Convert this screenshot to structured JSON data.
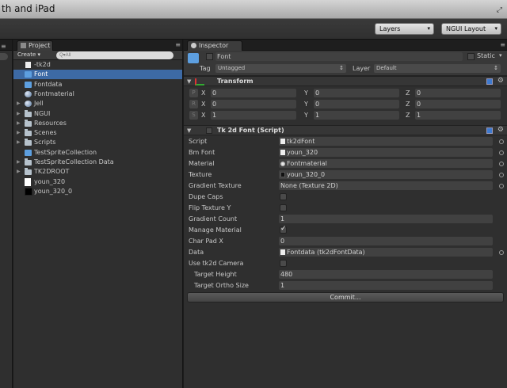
{
  "window": {
    "title": "th and iPad"
  },
  "toolbar": {
    "layers": "Layers",
    "layout": "NGUI Layout"
  },
  "project": {
    "tab": "Project",
    "create": "Create",
    "search_placeholder": "Q▾All",
    "items": [
      {
        "label": "-tk2d",
        "icon": "doc-icon",
        "folder": false
      },
      {
        "label": "Font",
        "icon": "cube-icon",
        "folder": false,
        "selected": true
      },
      {
        "label": "Fontdata",
        "icon": "cube-icon",
        "folder": false
      },
      {
        "label": "Fontmaterial",
        "icon": "sphere-icon",
        "folder": false
      },
      {
        "label": "Jell",
        "icon": "sphere-icon",
        "folder": true
      },
      {
        "label": "NGUI",
        "icon": "folder-icon",
        "folder": true
      },
      {
        "label": "Resources",
        "icon": "folder-icon",
        "folder": true
      },
      {
        "label": "Scenes",
        "icon": "folder-icon",
        "folder": true
      },
      {
        "label": "Scripts",
        "icon": "folder-icon",
        "folder": true
      },
      {
        "label": "TestSpriteCollection",
        "icon": "cube-icon",
        "folder": false
      },
      {
        "label": "TestSpriteCollection Data",
        "icon": "folder-icon",
        "folder": true
      },
      {
        "label": "TK2DROOT",
        "icon": "folder-icon",
        "folder": true
      },
      {
        "label": "youn_320",
        "icon": "white-image-icon",
        "folder": false
      },
      {
        "label": "youn_320_0",
        "icon": "black-image-icon",
        "folder": false
      }
    ]
  },
  "inspector": {
    "tab": "Inspector",
    "object_name": "Font",
    "static_label": "Static",
    "tag_label": "Tag",
    "tag_value": "Untagged",
    "layer_label": "Layer",
    "layer_value": "Default",
    "transform": {
      "title": "Transform",
      "rows": [
        {
          "btn": "P",
          "x": "0",
          "y": "0",
          "z": "0"
        },
        {
          "btn": "R",
          "x": "0",
          "y": "0",
          "z": "0"
        },
        {
          "btn": "S",
          "x": "1",
          "y": "1",
          "z": "1"
        }
      ],
      "x_label": "X",
      "y_label": "Y",
      "z_label": "Z"
    },
    "font_script": {
      "title": "Tk 2d Font (Script)",
      "script_label": "Script",
      "script_value": "tk2dFont",
      "bmfont_label": "Bm Font",
      "bmfont_value": "youn_320",
      "material_label": "Material",
      "material_value": "Fontmaterial",
      "texture_label": "Texture",
      "texture_value": "youn_320_0",
      "gradient_texture_label": "Gradient Texture",
      "gradient_texture_value": "None (Texture 2D)",
      "dupe_caps_label": "Dupe Caps",
      "dupe_caps": false,
      "flip_texture_y_label": "Flip Texture Y",
      "flip_texture_y": false,
      "gradient_count_label": "Gradient Count",
      "gradient_count_value": "1",
      "manage_material_label": "Manage Material",
      "manage_material": true,
      "char_pad_x_label": "Char Pad X",
      "char_pad_x_value": "0",
      "data_label": "Data",
      "data_value": "Fontdata (tk2dFontData)",
      "use_camera_label": "Use tk2d Camera",
      "use_camera": false,
      "target_height_label": "Target Height",
      "target_height_value": "480",
      "target_ortho_label": "Target Ortho Size",
      "target_ortho_value": "1",
      "commit_label": "Commit..."
    }
  }
}
